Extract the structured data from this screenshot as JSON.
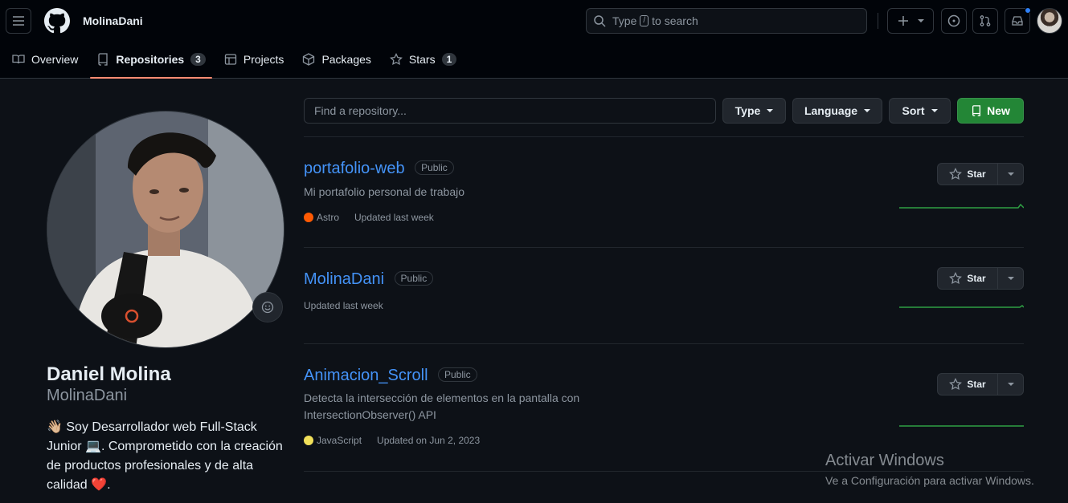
{
  "header": {
    "username": "MolinaDani",
    "search": {
      "prefix": "Type",
      "key": "/",
      "suffix": "to search"
    }
  },
  "tabs": [
    {
      "label": "Overview",
      "icon": "book-icon"
    },
    {
      "label": "Repositories",
      "icon": "repo-icon",
      "count": "3",
      "active": true
    },
    {
      "label": "Projects",
      "icon": "table-icon"
    },
    {
      "label": "Packages",
      "icon": "package-icon"
    },
    {
      "label": "Stars",
      "icon": "star-icon",
      "count": "1"
    }
  ],
  "profile": {
    "name": "Daniel Molina",
    "login": "MolinaDani",
    "bio_1": "👋🏼 Soy Desarrollador web Full-Stack Junior 💻. Comprometido con la creación de productos profesionales y de alta calidad ❤️."
  },
  "filters": {
    "find_placeholder": "Find a repository...",
    "type": "Type",
    "language": "Language",
    "sort": "Sort",
    "new": "New"
  },
  "repos": [
    {
      "name": "portafolio-web",
      "visibility": "Public",
      "description": "Mi portafolio personal de trabajo",
      "language": "Astro",
      "language_color": "#ff5a03",
      "updated": "Updated last week",
      "star": "Star"
    },
    {
      "name": "MolinaDani",
      "visibility": "Public",
      "description": "",
      "language": "",
      "language_color": "",
      "updated": "Updated last week",
      "star": "Star"
    },
    {
      "name": "Animacion_Scroll",
      "visibility": "Public",
      "description_line1": "Detecta la intersección de elementos en la pantalla con",
      "description_line2": "IntersectionObserver() API",
      "language": "JavaScript",
      "language_color": "#f1e05a",
      "updated": "Updated on Jun 2, 2023",
      "star": "Star"
    }
  ],
  "watermark": {
    "title": "Activar Windows",
    "subtitle": "Ve a Configuración para activar Windows."
  },
  "colors": {
    "accent": "#4493f8",
    "tab_underline": "#fd8c73",
    "new_button": "#238636",
    "spark": "#2ea043"
  }
}
